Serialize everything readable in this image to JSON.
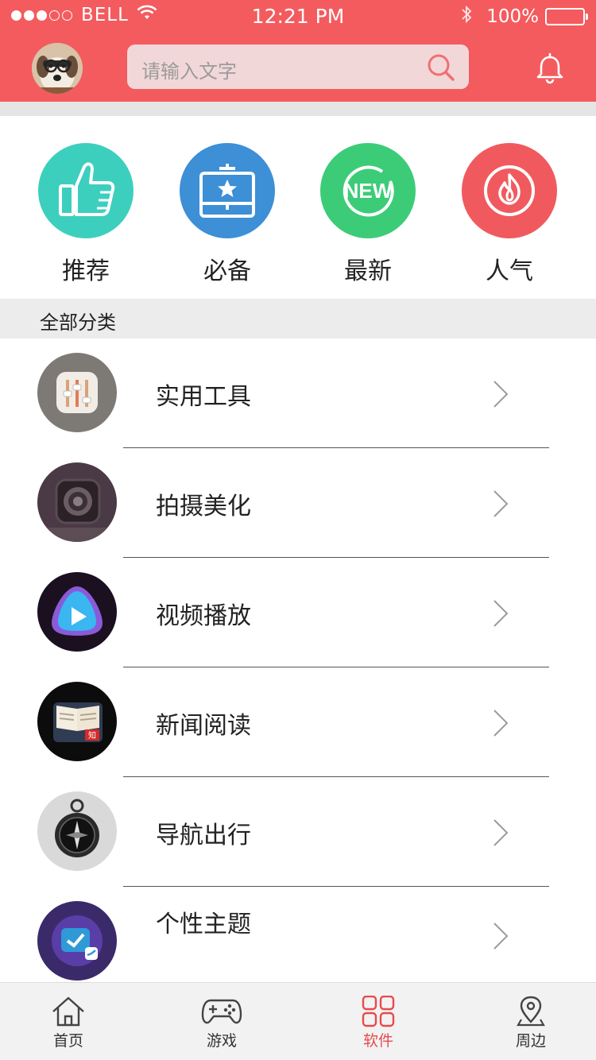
{
  "status_bar": {
    "carrier": "BELL",
    "time": "12:21 PM",
    "battery": "100%",
    "signal_bars_filled": 3,
    "signal_bars_total": 5
  },
  "header": {
    "search_placeholder": "请输入文字",
    "icons": [
      "avatar",
      "search-icon",
      "bell-icon"
    ]
  },
  "quick_categories": [
    {
      "label": "推荐",
      "icon": "thumbs-up-icon",
      "color": "#3dcfbe"
    },
    {
      "label": "必备",
      "icon": "toolbox-star-icon",
      "color": "#3d8fd6"
    },
    {
      "label": "最新",
      "icon": "new-badge-icon",
      "color": "#3ccc77",
      "badge_text": "NEW"
    },
    {
      "label": "人气",
      "icon": "flame-icon",
      "color": "#f05a5e"
    }
  ],
  "section_title": "全部分类",
  "categories": [
    {
      "label": "实用工具",
      "icon": "tools-app-icon"
    },
    {
      "label": "拍摄美化",
      "icon": "camera-app-icon"
    },
    {
      "label": "视频播放",
      "icon": "video-player-app-icon"
    },
    {
      "label": "新闻阅读",
      "icon": "news-reader-app-icon",
      "badge_text": "知"
    },
    {
      "label": "导航出行",
      "icon": "compass-app-icon"
    },
    {
      "label": "个性主题",
      "icon": "theme-app-icon"
    }
  ],
  "tabbar": {
    "active_index": 2,
    "tabs": [
      {
        "label": "首页",
        "icon": "home-icon"
      },
      {
        "label": "游戏",
        "icon": "gamepad-icon"
      },
      {
        "label": "软件",
        "icon": "grid-apps-icon"
      },
      {
        "label": "周边",
        "icon": "location-pin-icon"
      }
    ]
  },
  "colors": {
    "header": "#f45b5e",
    "active_tab": "#e64b4e"
  }
}
